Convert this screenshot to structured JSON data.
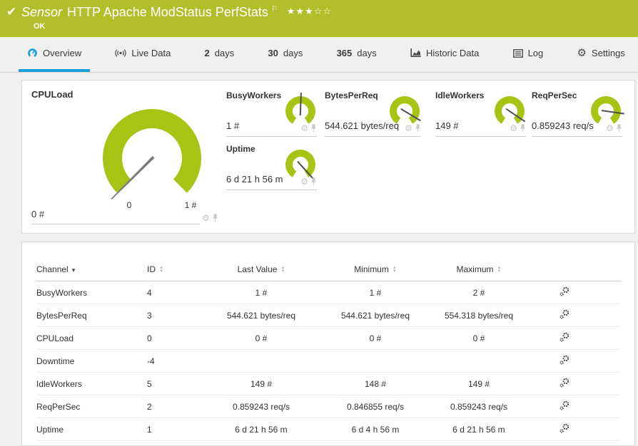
{
  "colors": {
    "header_green": "#b2bf2a",
    "gauge_green": "#a5c413",
    "accent_blue": "#18a2d9",
    "needle_gray": "#7b7b7b",
    "panel_border": "#d9d9d9"
  },
  "header": {
    "check_glyph": "✔",
    "type_label": "Sensor",
    "title": "HTTP Apache ModStatus PerfStats",
    "flag_glyph": "⚐",
    "rating": "★★★☆☆",
    "status": "OK"
  },
  "tabs": [
    {
      "label": "Overview",
      "icon": "gauge-icon",
      "active": true
    },
    {
      "label": "Live Data",
      "icon": "live-data-icon"
    },
    {
      "prefix": "2",
      "label": "days"
    },
    {
      "prefix": "30",
      "label": "days"
    },
    {
      "prefix": "365",
      "label": "days"
    },
    {
      "label": "Historic Data",
      "icon": "historic-chart-icon"
    },
    {
      "label": "Log",
      "icon": "log-icon"
    },
    {
      "label": "Settings",
      "icon": "settings-gear-icon",
      "gear_glyph": "⚙"
    }
  ],
  "overview": {
    "big_gauge": {
      "name": "CPULoad",
      "value": "0 #",
      "scale_min": "0",
      "scale_max": "1 #",
      "gear_glyph": "⚙"
    },
    "small_gauges": [
      {
        "name": "BusyWorkers",
        "value": "1 #",
        "gear_glyph": "⚙"
      },
      {
        "name": "BytesPerReq",
        "value": "544.621 bytes/req",
        "gear_glyph": "⚙"
      },
      {
        "name": "IdleWorkers",
        "value": "149 #",
        "gear_glyph": "⚙"
      },
      {
        "name": "ReqPerSec",
        "value": "0.859243 req/s",
        "gear_glyph": "⚙"
      },
      {
        "name": "Uptime",
        "value": "6 d 21 h 56 m",
        "gear_glyph": "⚙"
      }
    ]
  },
  "channel_table": {
    "headers": {
      "channel": "Channel",
      "id": "ID",
      "last_value": "Last Value",
      "minimum": "Minimum",
      "maximum": "Maximum"
    },
    "sort_caret": "▾",
    "rows": [
      {
        "channel": "BusyWorkers",
        "id": "4",
        "last": "1 #",
        "min": "1 #",
        "max": "2 #"
      },
      {
        "channel": "BytesPerReq",
        "id": "3",
        "last": "544.621 bytes/req",
        "min": "544.621 bytes/req",
        "max": "554.318 bytes/req"
      },
      {
        "channel": "CPULoad",
        "id": "0",
        "last": "0 #",
        "min": "0 #",
        "max": "0 #"
      },
      {
        "channel": "Downtime",
        "id": "-4",
        "last": "",
        "min": "",
        "max": ""
      },
      {
        "channel": "IdleWorkers",
        "id": "5",
        "last": "149 #",
        "min": "148 #",
        "max": "149 #"
      },
      {
        "channel": "ReqPerSec",
        "id": "2",
        "last": "0.859243 req/s",
        "min": "0.846855 req/s",
        "max": "0.859243 req/s"
      },
      {
        "channel": "Uptime",
        "id": "1",
        "last": "6 d 21 h 56 m",
        "min": "6 d 4 h 56 m",
        "max": "6 d 21 h 56 m"
      }
    ]
  }
}
